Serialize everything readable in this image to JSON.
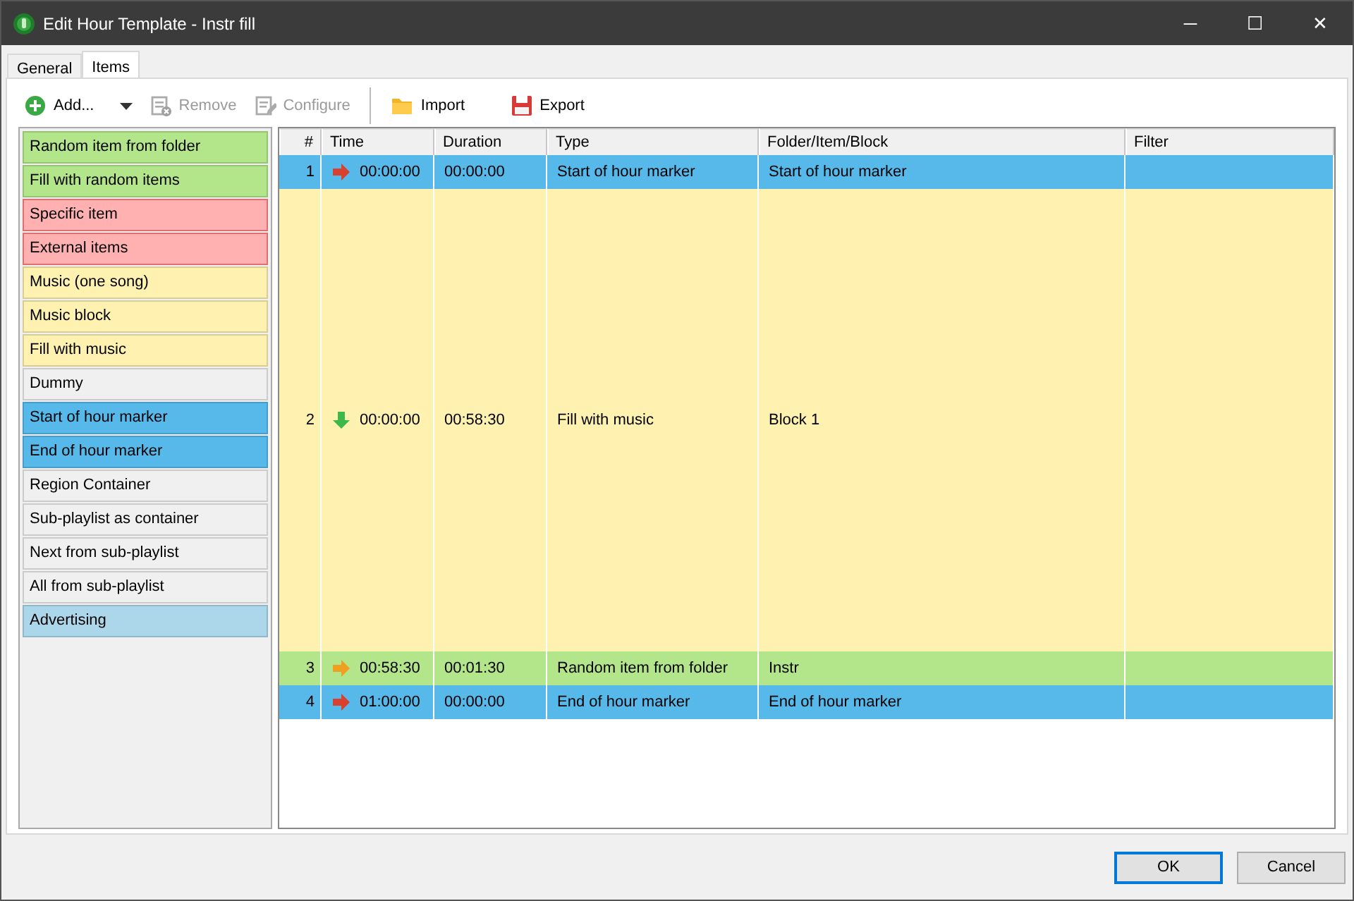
{
  "window": {
    "title": "Edit Hour Template - Instr fill",
    "controls": [
      "─",
      "☐",
      "✕"
    ]
  },
  "tabs": [
    {
      "label": "General",
      "selected": false
    },
    {
      "label": "Items",
      "selected": true
    }
  ],
  "toolbar": [
    {
      "kind": "add",
      "label": "Add...",
      "disabled": false
    },
    {
      "kind": "remove",
      "label": "Remove",
      "disabled": true
    },
    {
      "kind": "configure",
      "label": "Configure",
      "disabled": true
    },
    {
      "kind": "import",
      "label": "Import",
      "disabled": false
    },
    {
      "kind": "export",
      "label": "Export",
      "disabled": false
    }
  ],
  "palette": [
    {
      "label": "Random item from folder",
      "color": "#b3e58a"
    },
    {
      "label": "Fill with random items",
      "color": "#b3e58a"
    },
    {
      "label": "Specific item",
      "color": "#ffb0b0"
    },
    {
      "label": "External items",
      "color": "#ffb0b0"
    },
    {
      "label": "Music (one song)",
      "color": "#fff1b0"
    },
    {
      "label": "Music block",
      "color": "#fff1b0"
    },
    {
      "label": "Fill with music",
      "color": "#fff1b0"
    },
    {
      "label": "Dummy",
      "color": "#f0f0f0"
    },
    {
      "label": "Start of hour marker",
      "color": "#56b9ea"
    },
    {
      "label": "End of hour marker",
      "color": "#56b9ea"
    },
    {
      "label": "Region Container",
      "color": "#f0f0f0"
    },
    {
      "label": "Sub-playlist as container",
      "color": "#f0f0f0"
    },
    {
      "label": "Next from sub-playlist",
      "color": "#f0f0f0"
    },
    {
      "label": "All from sub-playlist",
      "color": "#f0f0f0"
    },
    {
      "label": "Advertising",
      "color": "#acd7ea"
    }
  ],
  "table": {
    "columns": [
      "#",
      "Time",
      "Duration",
      "Type",
      "Folder/Item/Block",
      "Filter"
    ],
    "rows": [
      {
        "number": "1",
        "marker": {
          "kind": "right",
          "color": "#d9412e"
        },
        "time": "00:00:00",
        "duration": "00:00:00",
        "type": "Start of hour marker",
        "folder": "Start of hour marker",
        "color": "#56b9ea"
      },
      {
        "number": "2",
        "marker": {
          "kind": "down",
          "color": "#3cb94a"
        },
        "time": "00:00:00",
        "duration": "00:58:30",
        "type": "Fill with music",
        "folder": "Block 1",
        "color": "#fff1b0"
      },
      {
        "number": "3",
        "marker": {
          "kind": "right",
          "color": "#f0a020"
        },
        "time": "00:58:30",
        "duration": "00:01:30",
        "type": "Random item from folder",
        "folder": "Instr",
        "color": "#b3e58a"
      },
      {
        "number": "4",
        "marker": {
          "kind": "right",
          "color": "#d9412e"
        },
        "time": "01:00:00",
        "duration": "00:00:00",
        "type": "End of hour marker",
        "folder": "End of hour marker",
        "color": "#56b9ea"
      }
    ]
  },
  "buttons": [
    {
      "label": "OK",
      "default": true
    },
    {
      "label": "Cancel",
      "default": false
    }
  ]
}
